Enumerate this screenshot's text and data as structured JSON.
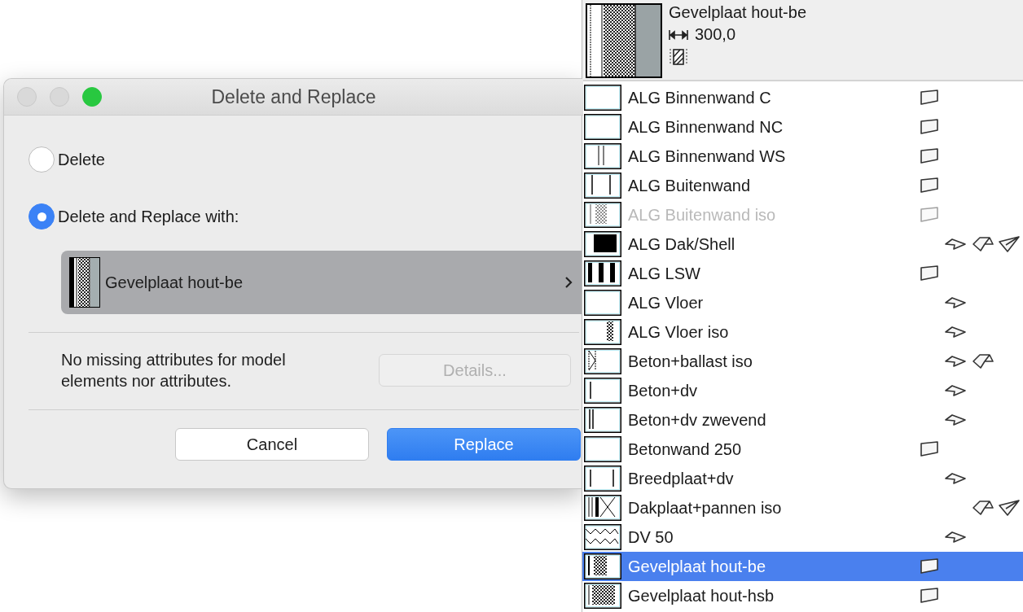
{
  "dialog": {
    "title": "Delete and Replace",
    "window_controls": [
      {
        "kind": "close",
        "disabled": true
      },
      {
        "kind": "minimize",
        "disabled": true
      },
      {
        "kind": "zoom",
        "disabled": false
      }
    ],
    "options": [
      {
        "label": "Delete",
        "selected": false
      },
      {
        "label": "Delete and Replace with:",
        "selected": true
      }
    ],
    "replacement": {
      "label": "Gevelplaat hout-be"
    },
    "info": "No missing attributes for model elements nor attributes.",
    "details_button": {
      "label": "Details...",
      "disabled": true
    },
    "buttons": [
      {
        "label": "Cancel",
        "default": false
      },
      {
        "label": "Replace",
        "default": true
      }
    ]
  },
  "popup": {
    "header": {
      "name": "Gevelplaat hout-be",
      "thickness": "300,0"
    },
    "rows": [
      {
        "label": "ALG Binnenwand C",
        "swatch": {
          "kind": "empty"
        },
        "icons": [
          {
            "kind": "wall"
          }
        ],
        "selected": false,
        "disabled": false
      },
      {
        "label": "ALG Binnenwand NC",
        "swatch": {
          "kind": "empty"
        },
        "icons": [
          {
            "kind": "wall"
          }
        ],
        "selected": false,
        "disabled": false
      },
      {
        "label": "ALG Binnenwand WS",
        "swatch": {
          "kind": "double-line"
        },
        "icons": [
          {
            "kind": "wall"
          }
        ],
        "selected": false,
        "disabled": false
      },
      {
        "label": "ALG Buitenwand",
        "swatch": {
          "kind": "two-lines"
        },
        "icons": [
          {
            "kind": "wall"
          }
        ],
        "selected": false,
        "disabled": false
      },
      {
        "label": "ALG Buitenwand iso",
        "swatch": {
          "kind": "iso"
        },
        "icons": [
          {
            "kind": "wall"
          }
        ],
        "selected": false,
        "disabled": true
      },
      {
        "label": "ALG Dak/Shell",
        "swatch": {
          "kind": "solid"
        },
        "icons": [
          {
            "kind": "slab"
          },
          {
            "kind": "roof"
          },
          {
            "kind": "shell"
          }
        ],
        "selected": false,
        "disabled": false
      },
      {
        "label": "ALG LSW",
        "swatch": {
          "kind": "bars"
        },
        "icons": [
          {
            "kind": "wall"
          }
        ],
        "selected": false,
        "disabled": false
      },
      {
        "label": "ALG Vloer",
        "swatch": {
          "kind": "empty"
        },
        "icons": [
          {
            "kind": "slab"
          }
        ],
        "selected": false,
        "disabled": false
      },
      {
        "label": "ALG Vloer iso",
        "swatch": {
          "kind": "iso-right"
        },
        "icons": [
          {
            "kind": "slab"
          }
        ],
        "selected": false,
        "disabled": false
      },
      {
        "label": "Beton+ballast iso",
        "swatch": {
          "kind": "zigzag-left"
        },
        "icons": [
          {
            "kind": "slab"
          },
          {
            "kind": "roof"
          }
        ],
        "selected": false,
        "disabled": false
      },
      {
        "label": "Beton+dv",
        "swatch": {
          "kind": "line-left"
        },
        "icons": [
          {
            "kind": "slab"
          }
        ],
        "selected": false,
        "disabled": false
      },
      {
        "label": "Beton+dv zwevend",
        "swatch": {
          "kind": "double-left"
        },
        "icons": [
          {
            "kind": "slab"
          }
        ],
        "selected": false,
        "disabled": false
      },
      {
        "label": "Betonwand 250",
        "swatch": {
          "kind": "empty"
        },
        "icons": [
          {
            "kind": "wall"
          }
        ],
        "selected": false,
        "disabled": false
      },
      {
        "label": "Breedplaat+dv",
        "swatch": {
          "kind": "lines-both"
        },
        "icons": [
          {
            "kind": "slab"
          }
        ],
        "selected": false,
        "disabled": false
      },
      {
        "label": "Dakplaat+pannen iso",
        "swatch": {
          "kind": "cross"
        },
        "icons": [
          {
            "kind": "roof"
          },
          {
            "kind": "shell"
          }
        ],
        "selected": false,
        "disabled": false
      },
      {
        "label": "DV 50",
        "swatch": {
          "kind": "wave"
        },
        "icons": [
          {
            "kind": "slab"
          }
        ],
        "selected": false,
        "disabled": false
      },
      {
        "label": "Gevelplaat hout-be",
        "swatch": {
          "kind": "checker"
        },
        "icons": [
          {
            "kind": "wall"
          }
        ],
        "selected": true,
        "disabled": false
      },
      {
        "label": "Gevelplaat hout-hsb",
        "swatch": {
          "kind": "checker-wide"
        },
        "icons": [
          {
            "kind": "wall"
          }
        ],
        "selected": false,
        "disabled": false
      }
    ]
  }
}
